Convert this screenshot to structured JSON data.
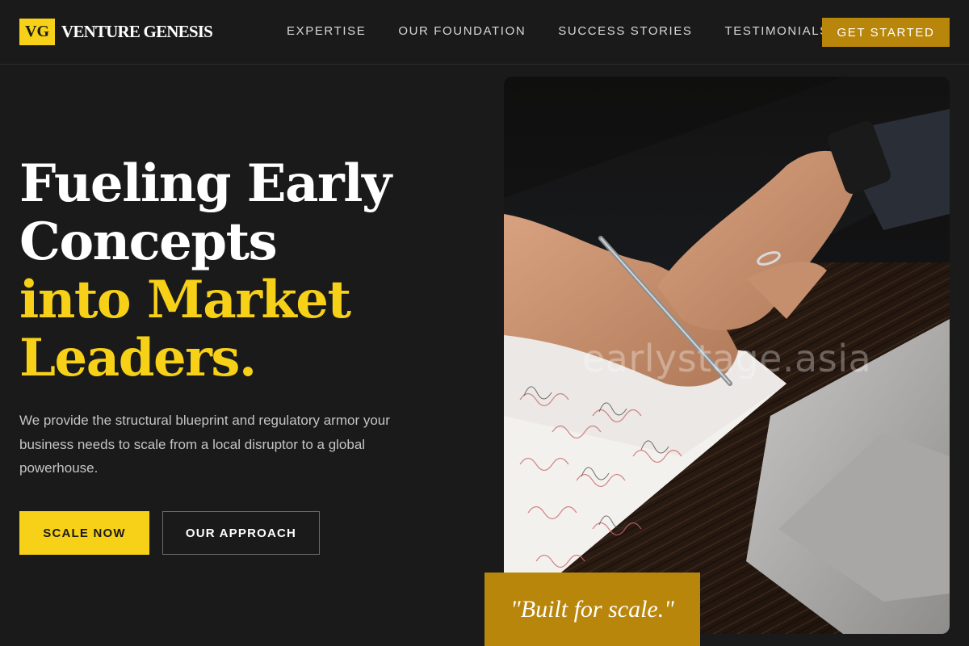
{
  "brand": {
    "mark": "VG",
    "name": "VENTURE GENESIS"
  },
  "nav": {
    "items": [
      {
        "label": "EXPERTISE"
      },
      {
        "label": "OUR FOUNDATION"
      },
      {
        "label": "SUCCESS STORIES"
      },
      {
        "label": "TESTIMONIALS"
      }
    ],
    "cta_label": "GET STARTED"
  },
  "hero": {
    "title_lines": [
      "Fueling Early",
      "Concepts",
      "into Market",
      "Leaders."
    ],
    "description": "We provide the structural blueprint and regulatory armor your business needs to scale from a local disruptor to a global powerhouse.",
    "primary_button": "SCALE NOW",
    "secondary_button": "OUR APPROACH"
  },
  "photo": {
    "watermark": "earlystage.asia",
    "quote": "\"Built for scale.\""
  },
  "colors": {
    "background": "#1a1a1a",
    "accent_yellow": "#f7d117",
    "accent_gold": "#b8860b",
    "text_muted": "#c4c4c4"
  },
  "icons": {
    "logo_mark": "vg-logo-icon",
    "hero_image": "signing-document-photo"
  }
}
